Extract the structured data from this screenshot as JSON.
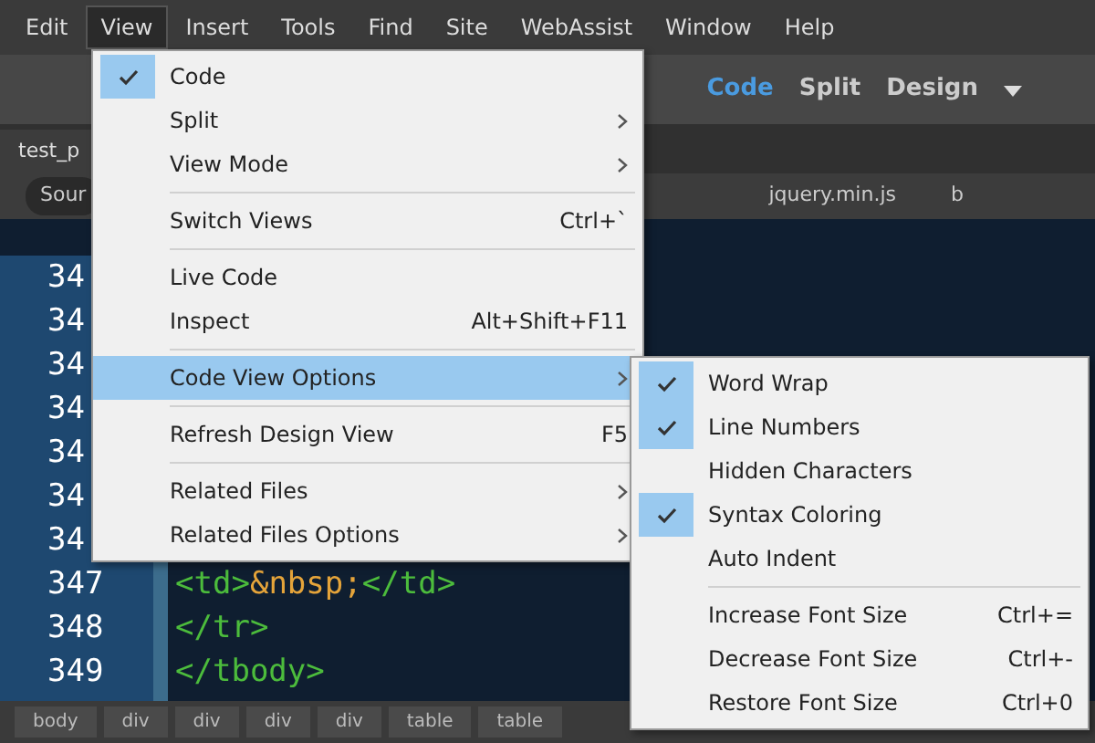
{
  "menubar": [
    {
      "label": "Edit",
      "selected": false
    },
    {
      "label": "View",
      "selected": true
    },
    {
      "label": "Insert",
      "selected": false
    },
    {
      "label": "Tools",
      "selected": false
    },
    {
      "label": "Find",
      "selected": false
    },
    {
      "label": "Site",
      "selected": false
    },
    {
      "label": "WebAssist",
      "selected": false
    },
    {
      "label": "Window",
      "selected": false
    },
    {
      "label": "Help",
      "selected": false
    }
  ],
  "view_switcher": [
    {
      "label": "Code",
      "selected": true
    },
    {
      "label": "Split",
      "selected": false
    },
    {
      "label": "Design",
      "selected": false
    }
  ],
  "document_tab": "test_p",
  "related_files": [
    {
      "label": "Sour",
      "selected": true
    },
    {
      "label": "jquery.min.js",
      "selected": false
    },
    {
      "label": "b",
      "selected": false
    }
  ],
  "code_lines": [
    {
      "number": "34"
    },
    {
      "number": "34"
    },
    {
      "number": "34"
    },
    {
      "number": "34"
    },
    {
      "number": "34"
    },
    {
      "number": "34"
    },
    {
      "number": "34"
    },
    {
      "number": "347",
      "code": [
        {
          "text": "<td>",
          "kind": "tag"
        },
        {
          "text": "&nbsp;",
          "kind": "entity"
        },
        {
          "text": "</td>",
          "kind": "tag"
        }
      ]
    },
    {
      "number": "348",
      "code": [
        {
          "text": "</tr>",
          "kind": "tag"
        }
      ]
    },
    {
      "number": "349",
      "code": [
        {
          "text": "</tbody>",
          "kind": "tag"
        }
      ]
    }
  ],
  "tag_selector": [
    "body",
    "div",
    "div",
    "div",
    "div",
    "table",
    "table"
  ],
  "view_menu": [
    {
      "kind": "item",
      "label": "Code",
      "checked": true
    },
    {
      "kind": "item",
      "label": "Split",
      "submenu": true
    },
    {
      "kind": "item",
      "label": "View Mode",
      "submenu": true
    },
    {
      "kind": "separator"
    },
    {
      "kind": "item",
      "label": "Switch Views",
      "shortcut": "Ctrl+`"
    },
    {
      "kind": "separator"
    },
    {
      "kind": "item",
      "label": "Live Code"
    },
    {
      "kind": "item",
      "label": "Inspect",
      "shortcut": "Alt+Shift+F11"
    },
    {
      "kind": "separator"
    },
    {
      "kind": "item",
      "label": "Code View Options",
      "submenu": true,
      "selected": true
    },
    {
      "kind": "separator"
    },
    {
      "kind": "item",
      "label": "Refresh Design View",
      "shortcut": "F5"
    },
    {
      "kind": "separator"
    },
    {
      "kind": "item",
      "label": "Related Files",
      "submenu": true
    },
    {
      "kind": "item",
      "label": "Related Files Options",
      "submenu": true
    }
  ],
  "code_view_options": [
    {
      "kind": "item",
      "label": "Word Wrap",
      "checked": true
    },
    {
      "kind": "item",
      "label": "Line Numbers",
      "checked": true
    },
    {
      "kind": "item",
      "label": "Hidden Characters",
      "checked": false
    },
    {
      "kind": "item",
      "label": "Syntax Coloring",
      "checked": true
    },
    {
      "kind": "item",
      "label": "Auto Indent",
      "checked": false
    },
    {
      "kind": "separator"
    },
    {
      "kind": "item",
      "label": "Increase Font Size",
      "shortcut": "Ctrl+="
    },
    {
      "kind": "item",
      "label": "Decrease Font Size",
      "shortcut": "Ctrl+-"
    },
    {
      "kind": "item",
      "label": "Restore Font Size",
      "shortcut": "Ctrl+0"
    }
  ]
}
